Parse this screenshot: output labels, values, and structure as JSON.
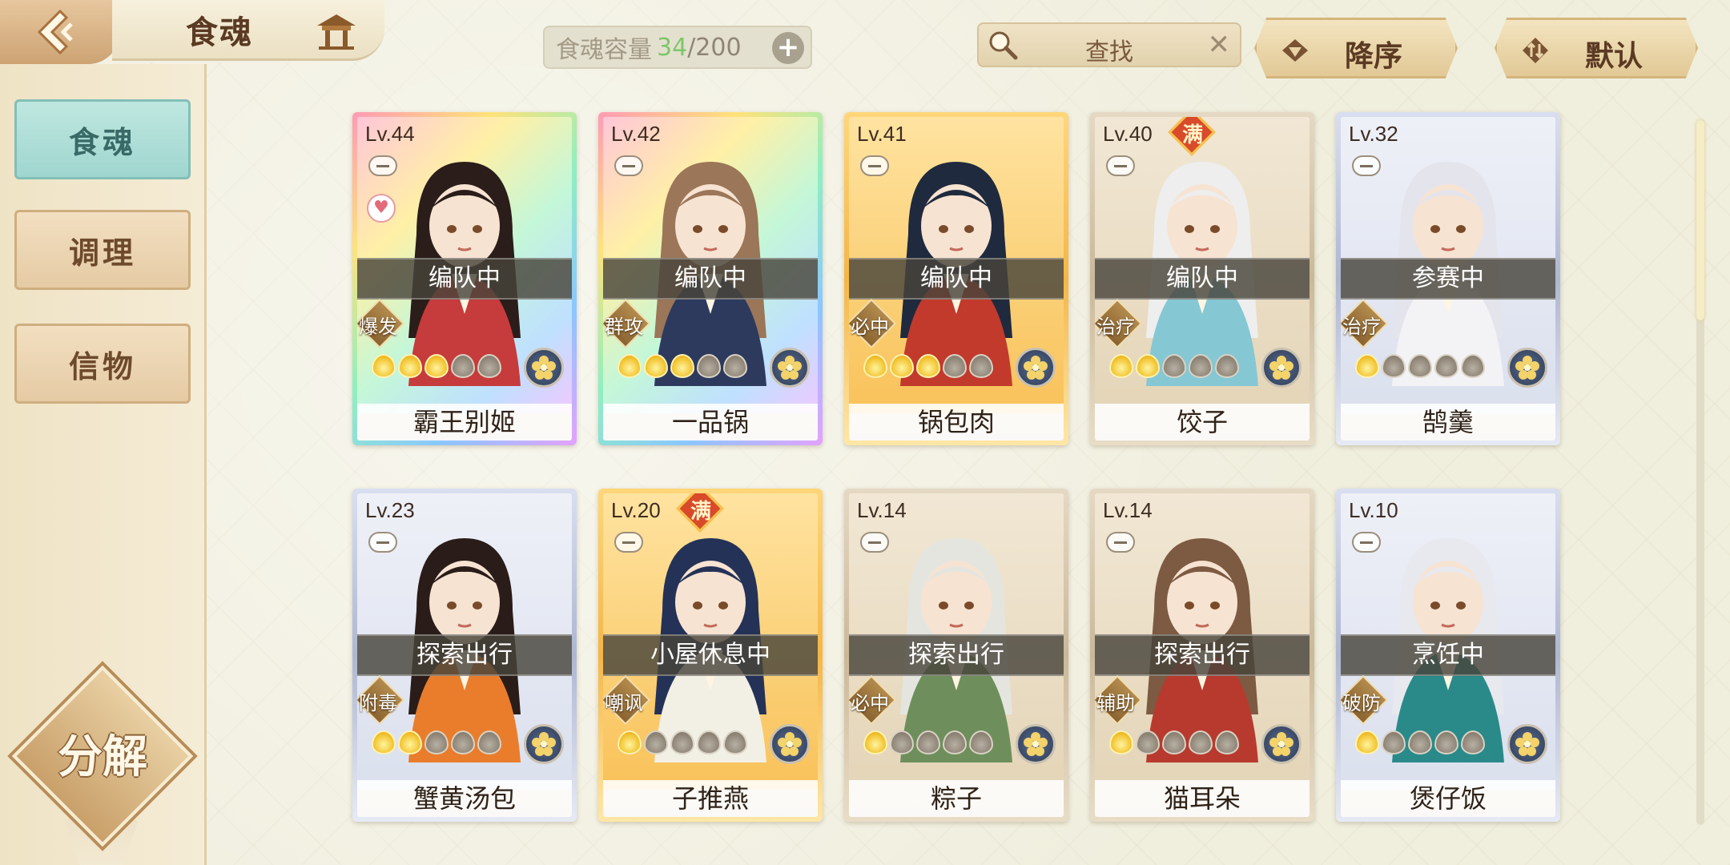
{
  "header": {
    "title": "食魂",
    "capacity_label": "食魂容量",
    "capacity_current": "34",
    "capacity_sep_max": "/200",
    "add_label": "+",
    "search_placeholder": "查找",
    "clear_label": "✕",
    "sort_order_label": "降序",
    "sort_mode_label": "默认"
  },
  "sidebar": {
    "items": [
      {
        "label": "食魂",
        "active": true
      },
      {
        "label": "调理",
        "active": false
      },
      {
        "label": "信物",
        "active": false
      }
    ],
    "disassemble_label": "分解"
  },
  "cards": [
    {
      "level": "Lv.44",
      "status": "编队中",
      "role": "爆发",
      "name": "霸王别姬",
      "stars_lit": 3,
      "full": false,
      "heart": true,
      "frame": "rainbow",
      "hair": "#2a1d1a",
      "robe": "#c63b3b"
    },
    {
      "level": "Lv.42",
      "status": "编队中",
      "role": "群攻",
      "name": "一品锅",
      "stars_lit": 3,
      "full": false,
      "heart": false,
      "frame": "rainbow",
      "hair": "#9b7658",
      "robe": "#2d3a5e"
    },
    {
      "level": "Lv.41",
      "status": "编队中",
      "role": "必中",
      "name": "锅包肉",
      "stars_lit": 3,
      "full": false,
      "heart": false,
      "frame": "gold",
      "hair": "#1f2a3e",
      "robe": "#c13a2c"
    },
    {
      "level": "Lv.40",
      "status": "编队中",
      "role": "治疗",
      "name": "饺子",
      "stars_lit": 2,
      "full": true,
      "full_label": "满",
      "heart": false,
      "frame": "bronze",
      "hair": "#eeeeee",
      "robe": "#86c7d4"
    },
    {
      "level": "Lv.32",
      "status": "参赛中",
      "role": "治疗",
      "name": "鹄羹",
      "stars_lit": 1,
      "full": false,
      "heart": false,
      "frame": "silverblue",
      "hair": "#e4e4ec",
      "robe": "#f3f3f6"
    },
    {
      "level": "Lv.23",
      "status": "探索出行",
      "role": "附毒",
      "name": "蟹黄汤包",
      "stars_lit": 2,
      "full": false,
      "heart": false,
      "frame": "silverblue",
      "hair": "#2a1c19",
      "robe": "#e97d2c"
    },
    {
      "level": "Lv.20",
      "status": "小屋休息中",
      "role": "嘲讽",
      "name": "子推燕",
      "stars_lit": 1,
      "full": true,
      "full_label": "满",
      "heart": false,
      "frame": "gold",
      "hair": "#253257",
      "robe": "#f2efe5"
    },
    {
      "level": "Lv.14",
      "status": "探索出行",
      "role": "必中",
      "name": "粽子",
      "stars_lit": 1,
      "full": false,
      "heart": false,
      "frame": "bronze",
      "hair": "#e5e5e0",
      "robe": "#6e8f5c"
    },
    {
      "level": "Lv.14",
      "status": "探索出行",
      "role": "辅助",
      "name": "猫耳朵",
      "stars_lit": 1,
      "full": false,
      "heart": false,
      "frame": "bronze",
      "hair": "#7d5a42",
      "robe": "#b83a2e"
    },
    {
      "level": "Lv.10",
      "status": "烹饪中",
      "role": "破防",
      "name": "煲仔饭",
      "stars_lit": 1,
      "full": false,
      "heart": false,
      "frame": "silverblue",
      "hair": "#e8e8ef",
      "robe": "#2a8a8a"
    }
  ]
}
